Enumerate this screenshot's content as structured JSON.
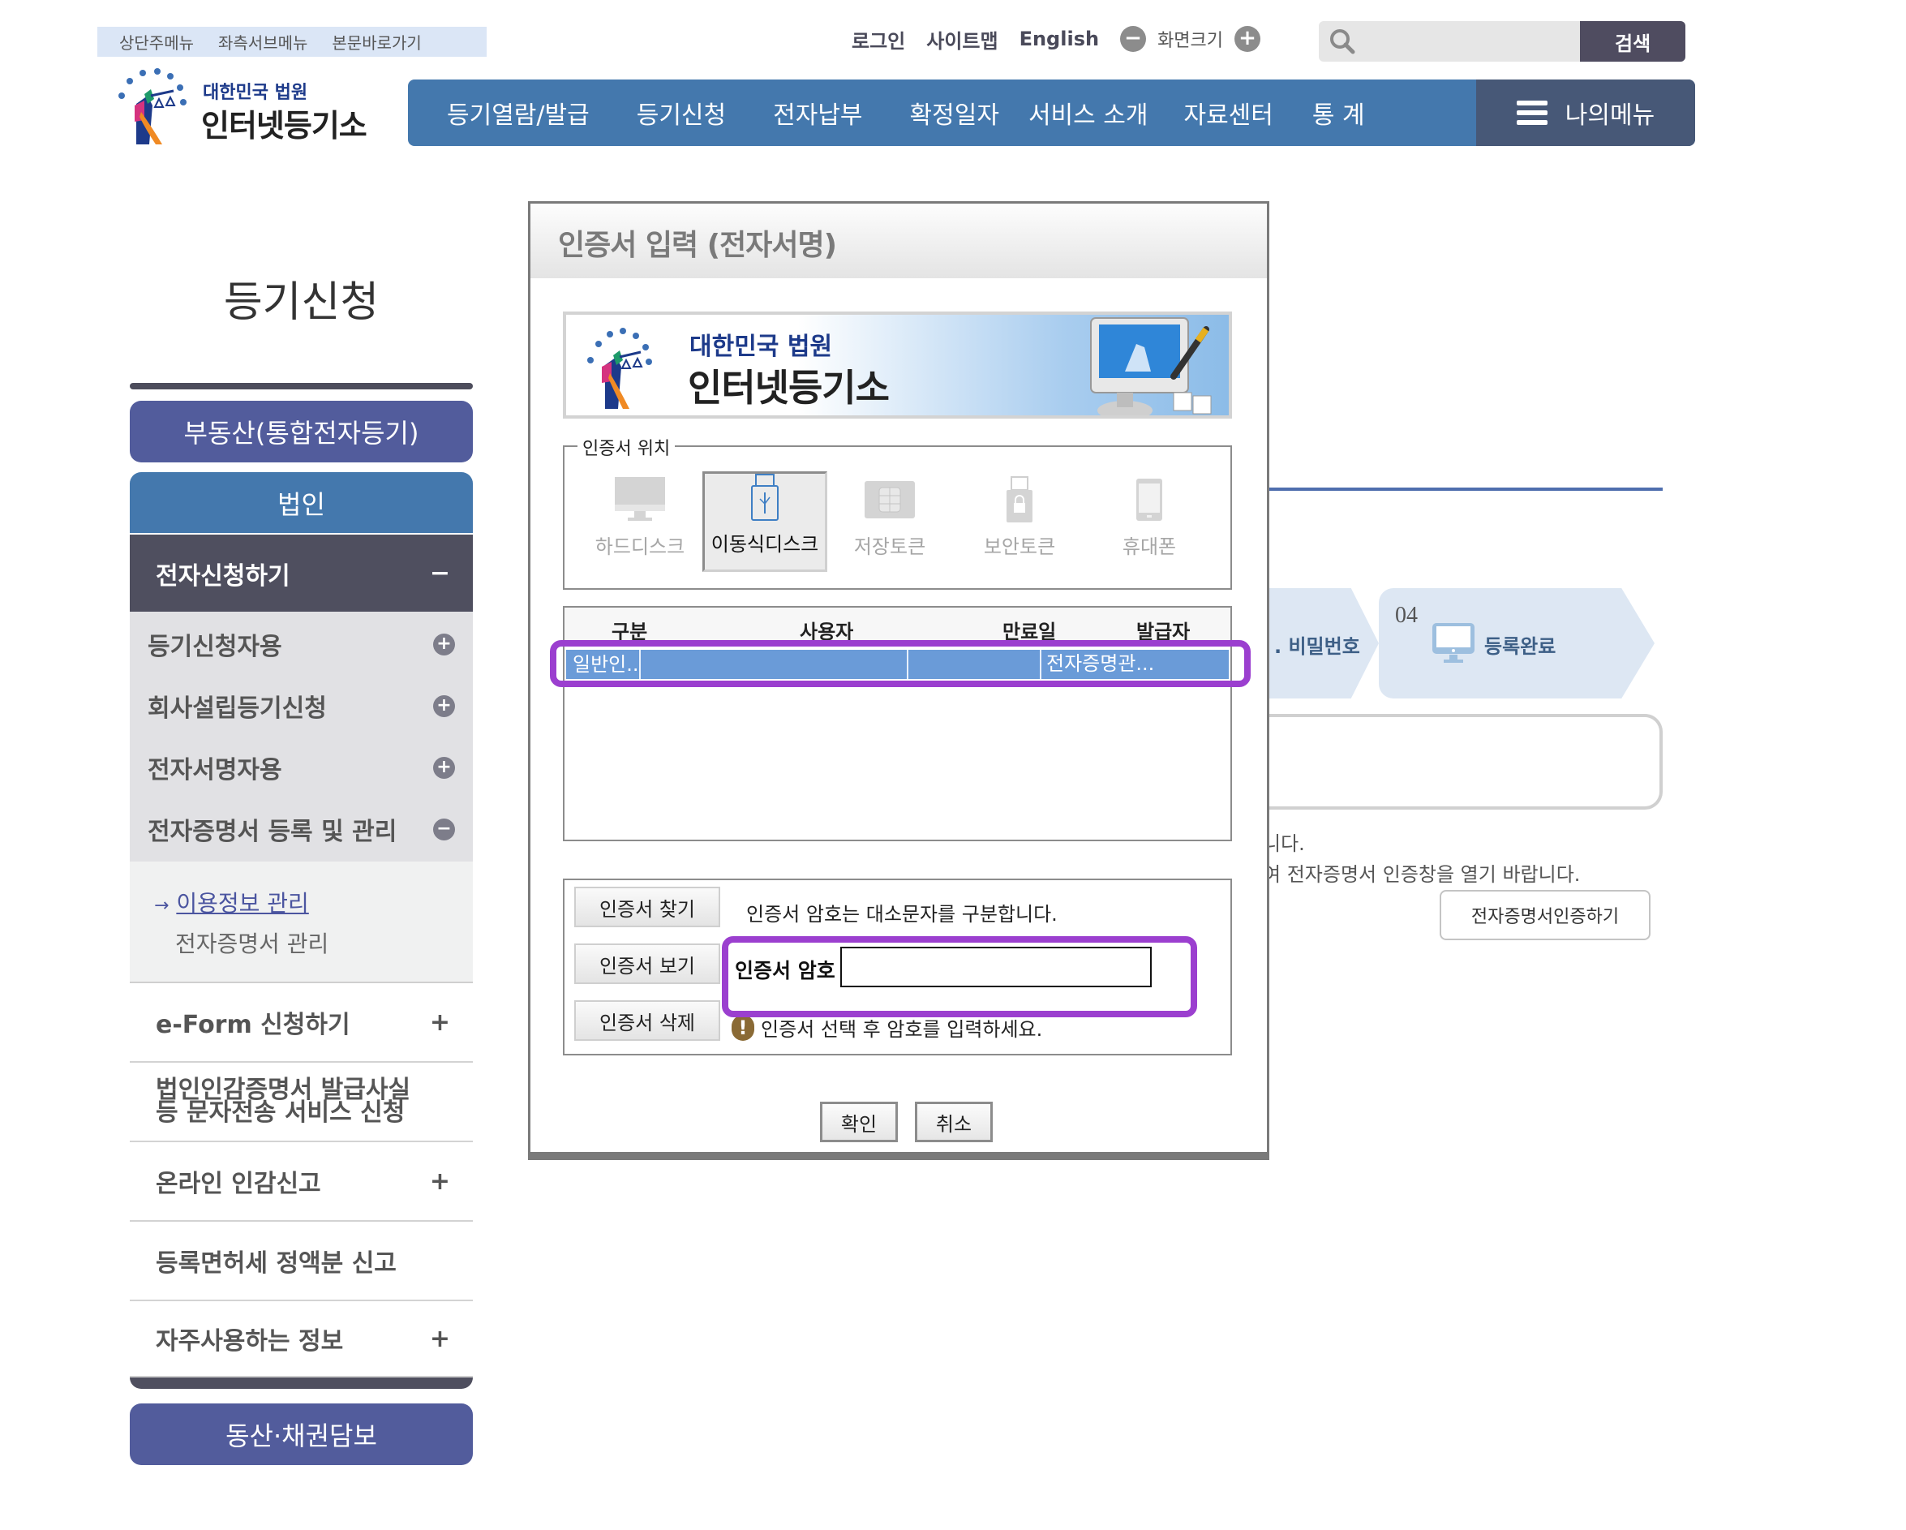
{
  "skip_links": [
    "상단주메뉴",
    "좌측서브메뉴",
    "본문바로가기"
  ],
  "logo": {
    "org": "대한민국 법원",
    "name": "인터넷등기소"
  },
  "util": {
    "login": "로그인",
    "sitemap": "사이트맵",
    "english": "English",
    "zoom_label": "화면크기",
    "zoom_out": "−",
    "zoom_in": "+"
  },
  "search": {
    "placeholder": "",
    "value": "",
    "button": "검색"
  },
  "nav": {
    "items": [
      "등기열람/발급",
      "등기신청",
      "전자납부",
      "확정일자",
      "서비스 소개",
      "자료센터",
      "통 계"
    ],
    "my_menu": "나의메뉴"
  },
  "sidebar": {
    "title": "등기신청",
    "real_estate": "부동산(통합전자등기)",
    "corporation": "법인",
    "e_apply": {
      "label": "전자신청하기",
      "toggle": "−"
    },
    "sub_items": [
      {
        "label": "등기신청자용",
        "toggle": "+"
      },
      {
        "label": "회사설립등기신청",
        "toggle": "+"
      },
      {
        "label": "전자서명자용",
        "toggle": "+"
      },
      {
        "label": "전자증명서 등록 및 관리",
        "toggle": "−"
      }
    ],
    "sub_sub": {
      "arrow": "→",
      "active": "이용정보 관리",
      "other": "전자증명서 관리"
    },
    "rows": [
      {
        "label": "e-Form 신청하기",
        "toggle": "+"
      },
      {
        "label": "법인인감증명서 발급사실\n등 문자전송 서비스 신청",
        "line1": "법인인감증명서 발급사실",
        "line2": "등 문자전송 서비스 신청",
        "toggle": ""
      },
      {
        "label": "온라인 인감신고",
        "toggle": "+"
      },
      {
        "label": "등록면허세 정액분 신고",
        "toggle": ""
      },
      {
        "label": "자주사용하는 정보",
        "toggle": "+"
      }
    ],
    "movable": "동산·채권담보"
  },
  "background": {
    "step3_label": ". 비밀번호",
    "step4_num": "04",
    "step4_label": "등록완료",
    "text1": "니다.",
    "text2": "여 전자증명서 인증창을 열기 바랍니다.",
    "cert_button": "전자증명서인증하기"
  },
  "dialog": {
    "title": "인증서 입력 (전자서명)",
    "banner": {
      "org": "대한민국 법원",
      "name": "인터넷등기소"
    },
    "location": {
      "legend": "인증서 위치",
      "options": [
        {
          "label": "하드디스크",
          "icon": "monitor-icon",
          "selected": false
        },
        {
          "label": "이동식디스크",
          "icon": "usb-icon",
          "selected": true
        },
        {
          "label": "저장토큰",
          "icon": "chip-card-icon",
          "selected": false
        },
        {
          "label": "보안토큰",
          "icon": "lock-token-icon",
          "selected": false
        },
        {
          "label": "휴대폰",
          "icon": "phone-icon",
          "selected": false
        }
      ]
    },
    "table": {
      "columns": [
        "구분",
        "사용자",
        "만료일",
        "발급자"
      ],
      "rows": [
        {
          "type": "일반인...",
          "user": "",
          "expiry": "",
          "issuer": "전자증명관...",
          "selected": true
        }
      ]
    },
    "buttons": {
      "find": "인증서 찾기",
      "view": "인증서 보기",
      "delete": "인증서 삭제"
    },
    "case_note": "인증서 암호는 대소문자를 구분합니다.",
    "password_label": "인증서 암호",
    "password_value": "",
    "warning": "인증서 선택 후 암호를 입력하세요.",
    "ok": "확인",
    "cancel": "취소"
  },
  "colors": {
    "nav_blue": "#4478ad",
    "my_menu": "#475877",
    "sidebar_purple": "#525c9c",
    "sidebar_dark": "#4f4f5f",
    "highlight": "#9b3fcf",
    "selected_row": "#6a9bd8"
  }
}
